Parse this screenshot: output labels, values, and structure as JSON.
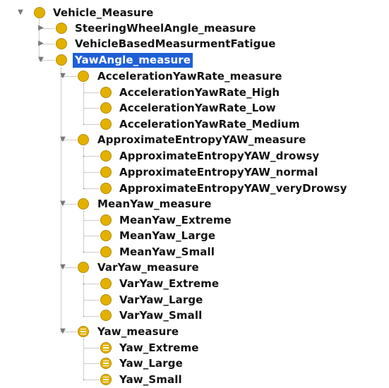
{
  "tree": {
    "root": {
      "label": "Vehicle_Measure",
      "expanded": true
    },
    "children": [
      {
        "label": "SteeringWheelAngle_measure",
        "expanded": false
      },
      {
        "label": "VehicleBasedMeasurmentFatigue",
        "expanded": false
      },
      {
        "label": "YawAngle_measure",
        "expanded": true,
        "selected": true,
        "children": [
          {
            "label": "AccelerationYawRate_measure",
            "expanded": true,
            "children": [
              {
                "label": "AccelerationYawRate_High"
              },
              {
                "label": "AccelerationYawRate_Low"
              },
              {
                "label": "AccelerationYawRate_Medium"
              }
            ]
          },
          {
            "label": "ApproximateEntropyYAW_measure",
            "expanded": true,
            "children": [
              {
                "label": "ApproximateEntropyYAW_drowsy"
              },
              {
                "label": "ApproximateEntropyYAW_normal"
              },
              {
                "label": "ApproximateEntropyYAW_veryDrowsy"
              }
            ]
          },
          {
            "label": "MeanYaw_measure",
            "expanded": true,
            "children": [
              {
                "label": "MeanYaw_Extreme"
              },
              {
                "label": "MeanYaw_Large"
              },
              {
                "label": "MeanYaw_Small"
              }
            ]
          },
          {
            "label": "VarYaw_measure",
            "expanded": true,
            "children": [
              {
                "label": "VarYaw_Extreme"
              },
              {
                "label": "VarYaw_Large"
              },
              {
                "label": "VarYaw_Small"
              }
            ]
          },
          {
            "label": "Yaw_measure",
            "expanded": true,
            "icon": "equivalent-class-icon",
            "children": [
              {
                "label": "Yaw_Extreme",
                "icon": "equivalent-class-icon"
              },
              {
                "label": "Yaw_Large",
                "icon": "equivalent-class-icon"
              },
              {
                "label": "Yaw_Small",
                "icon": "equivalent-class-icon"
              }
            ]
          }
        ]
      }
    ]
  },
  "colors": {
    "class_icon": "#e2b100",
    "selection_bg": "#1f5fd6"
  },
  "icons": {
    "expanded": "▼",
    "collapsed": "▶",
    "class": "class-icon",
    "equivalent": "equivalent-class-icon"
  }
}
